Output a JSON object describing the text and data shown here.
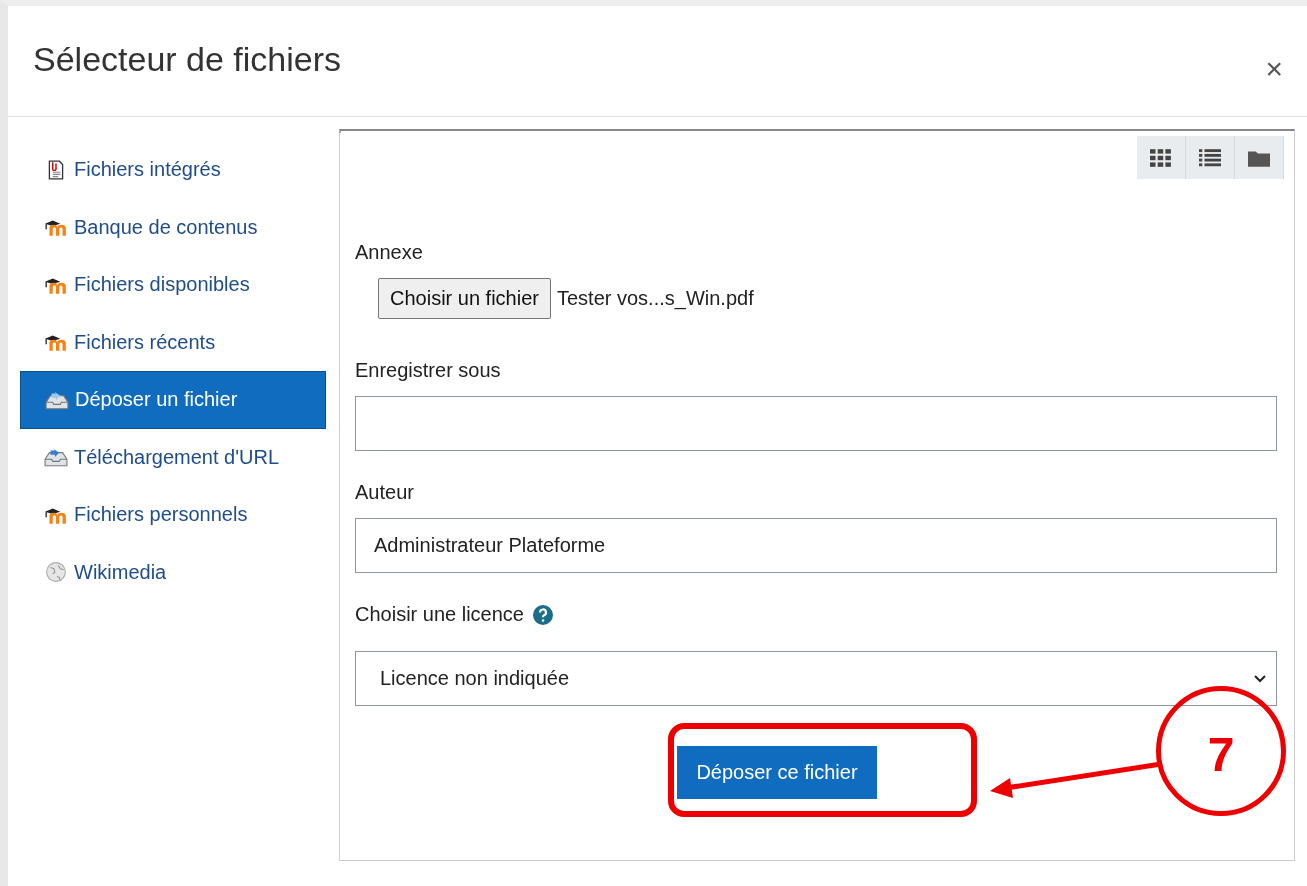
{
  "dialog": {
    "title": "Sélecteur de fichiers",
    "close": "×"
  },
  "sidebar": {
    "items": [
      {
        "label": "Fichiers intégrés",
        "kind": "file",
        "selected": false
      },
      {
        "label": "Banque de contenus",
        "kind": "moodle",
        "selected": false
      },
      {
        "label": "Fichiers disponibles",
        "kind": "moodle",
        "selected": false
      },
      {
        "label": "Fichiers récents",
        "kind": "moodle",
        "selected": false
      },
      {
        "label": "Déposer un fichier",
        "kind": "upload",
        "selected": true
      },
      {
        "label": "Téléchargement d'URL",
        "kind": "upload",
        "selected": false
      },
      {
        "label": "Fichiers personnels",
        "kind": "moodle",
        "selected": false
      },
      {
        "label": "Wikimedia",
        "kind": "wiki",
        "selected": false
      }
    ]
  },
  "toolbar": {
    "buttons": [
      {
        "kind": "grid"
      },
      {
        "kind": "list"
      },
      {
        "kind": "folder"
      }
    ]
  },
  "form": {
    "attachment": {
      "label": "Annexe",
      "button": "Choisir un fichier",
      "filename": "Tester vos...s_Win.pdf"
    },
    "save_as": {
      "label": "Enregistrer sous"
    },
    "author": {
      "label": "Auteur",
      "value": "Administrateur Plateforme"
    },
    "license": {
      "label": "Choisir une licence",
      "value": "Licence non indiquée"
    },
    "submit": "Déposer ce fichier"
  },
  "callout": {
    "number": "7"
  }
}
